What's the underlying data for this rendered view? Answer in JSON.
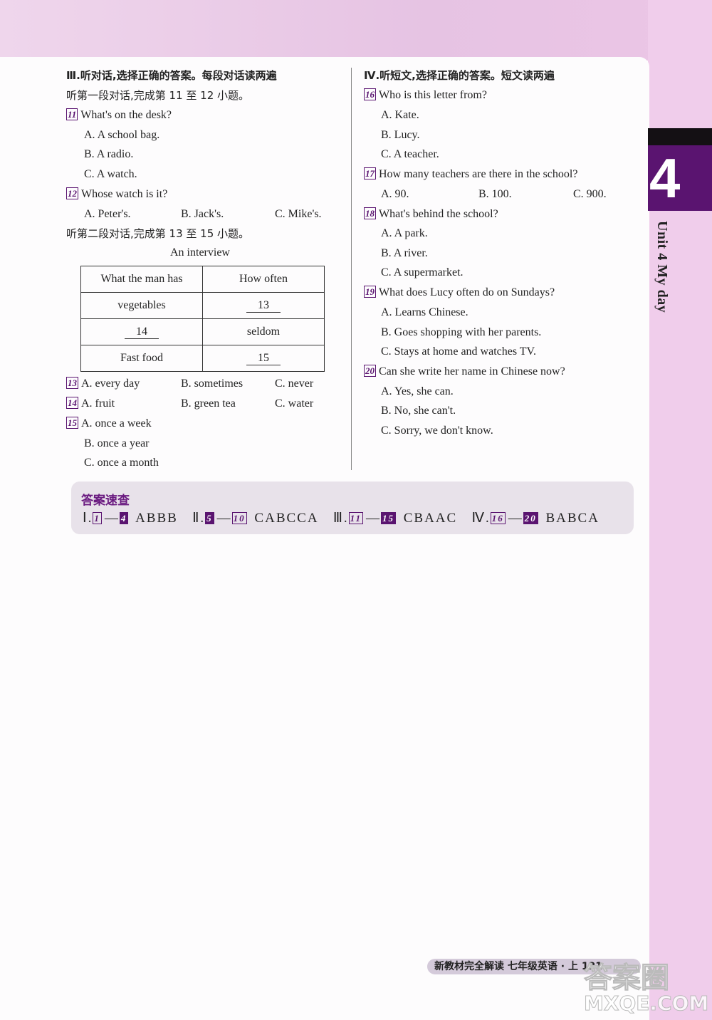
{
  "left": {
    "heading": "Ⅲ.听对话,选择正确的答案。每段对话读两遍",
    "part1": "听第一段对话,完成第 11 至 12 小题。",
    "q11": {
      "num": "11",
      "text": "What's on the desk?",
      "a": "A. A school bag.",
      "b": "B. A radio.",
      "c": "C. A watch."
    },
    "q12": {
      "num": "12",
      "text": "Whose watch is it?",
      "a": "A. Peter's.",
      "b": "B. Jack's.",
      "c": "C. Mike's."
    },
    "part2": "听第二段对话,完成第 13 至 15 小题。",
    "caption": "An interview",
    "table": {
      "headers": [
        "What the man has",
        "How often"
      ],
      "rows": [
        [
          "vegetables",
          "13"
        ],
        [
          "14",
          "seldom"
        ],
        [
          "Fast food",
          "15"
        ]
      ]
    },
    "q13": {
      "num": "13",
      "a": "A. every day",
      "b": "B. sometimes",
      "c": "C. never"
    },
    "q14": {
      "num": "14",
      "a": "A. fruit",
      "b": "B. green tea",
      "c": "C. water"
    },
    "q15": {
      "num": "15",
      "a": "A. once a week",
      "b": "B. once a year",
      "c": "C. once a month"
    }
  },
  "right": {
    "heading": "Ⅳ.听短文,选择正确的答案。短文读两遍",
    "q16": {
      "num": "16",
      "text": "Who is this letter from?",
      "a": "A. Kate.",
      "b": "B. Lucy.",
      "c": "C. A teacher."
    },
    "q17": {
      "num": "17",
      "text": "How many teachers are there in the school?",
      "a": "A. 90.",
      "b": "B. 100.",
      "c": "C. 900."
    },
    "q18": {
      "num": "18",
      "text": "What's behind the school?",
      "a": "A. A park.",
      "b": "B. A river.",
      "c": "C. A supermarket."
    },
    "q19": {
      "num": "19",
      "text": "What does Lucy often do on Sundays?",
      "a": "A. Learns Chinese.",
      "b": "B. Goes shopping with her parents.",
      "c": "C. Stays at home and watches TV."
    },
    "q20": {
      "num": "20",
      "text": "Can she write her name in Chinese now?",
      "a": "A. Yes, she can.",
      "b": "B. No, she can't.",
      "c": "C. Sorry, we don't know."
    }
  },
  "answers": {
    "title": "答案速查",
    "groups": [
      {
        "roman": "Ⅰ.",
        "from": "1",
        "to": "4",
        "ans": "ABBB"
      },
      {
        "roman": "Ⅱ.",
        "from": "5",
        "to": "10",
        "ans": "CABCCA"
      },
      {
        "roman": "Ⅲ.",
        "from": "11",
        "to": "15",
        "ans": "CBAAC"
      },
      {
        "roman": "Ⅳ.",
        "from": "16",
        "to": "20",
        "ans": "BABCA"
      }
    ]
  },
  "tab": {
    "number": "4",
    "unit": "Unit  4  My day"
  },
  "footer": {
    "text": "新教材完全解读  七年级英语 · 上",
    "page": "121"
  },
  "watermark": {
    "line1": "答案圈",
    "line2": "MXQE.COM"
  },
  "colors": {
    "accent": "#5a1470",
    "band": "#f0cdeb"
  }
}
